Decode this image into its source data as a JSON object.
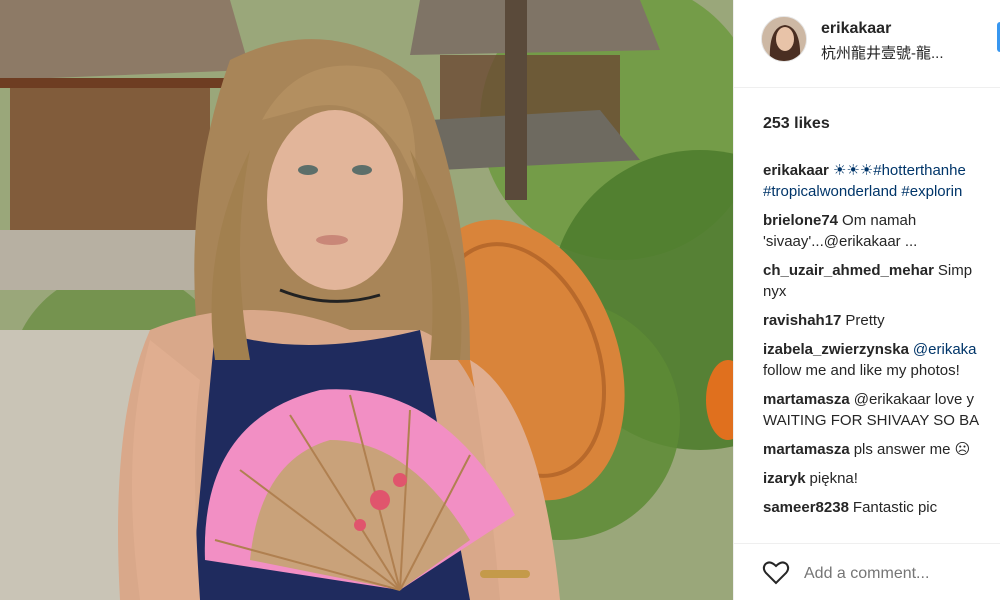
{
  "post": {
    "image_alt": "Photo of a young woman holding a pink folding fan with a woven hat behind her in a garden with wooden pavilions",
    "colors": {
      "fan": "#f28fc4",
      "hat": "#d9843a",
      "dress": "#1f2b5e",
      "foliage": "#5f8a35"
    }
  },
  "header": {
    "username": "erikakaar",
    "location": "杭州龍井壹號-龍..."
  },
  "likes": "253 likes",
  "comments": [
    {
      "user": "erikakaar",
      "line1": "☀☀☀#hotterthanhe",
      "line2": "#tropicalwonderland #explorin"
    },
    {
      "user": "brielone74",
      "line1": "Om namah",
      "line2": "'sivaay'...@erikakaar ..."
    },
    {
      "user": "ch_uzair_ahmed_mehar",
      "line1": "Simp",
      "line2": "nyx"
    },
    {
      "user": "ravishah17",
      "line1": "Pretty",
      "line2": ""
    },
    {
      "user": "izabela_zwierzynska",
      "line1": "@erikaka",
      "line2": "follow me and like my photos!"
    },
    {
      "user": "martamasza",
      "line1": "@erikakaar love y",
      "line2": "WAITING FOR SHIVAAY SO BA"
    },
    {
      "user": "martamasza",
      "line1": "pls answer me ☹",
      "line2": ""
    },
    {
      "user": "izaryk",
      "line1": "piękna!",
      "line2": ""
    },
    {
      "user": "sameer8238",
      "line1": "Fantastic pic",
      "line2": ""
    }
  ],
  "comment_bar": {
    "heart_icon": "heart-outline-icon",
    "placeholder": "Add a comment..."
  }
}
